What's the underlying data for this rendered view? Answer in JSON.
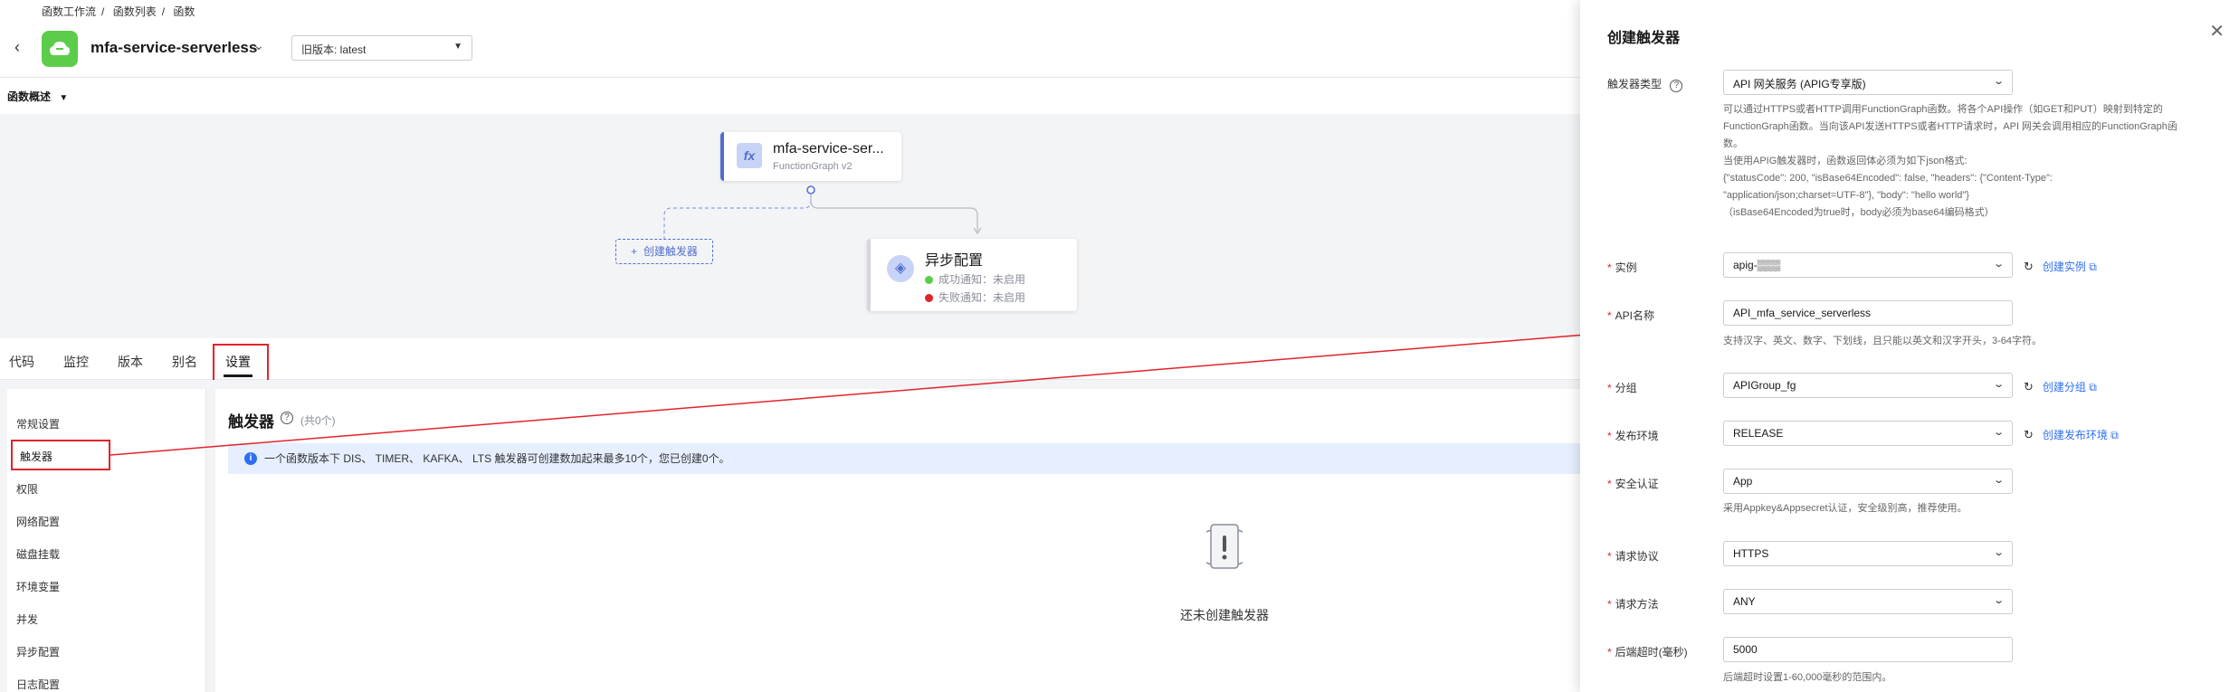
{
  "breadcrumb": [
    "函数工作流",
    "函数列表",
    "函数"
  ],
  "header": {
    "function_name": "mfa-service-serverless",
    "version_label": "旧版本: latest"
  },
  "overview": {
    "title": "函数概述",
    "function_node": {
      "title": "mfa-service-ser...",
      "subtitle": "FunctionGraph v2"
    },
    "create_trigger": "创建触发器",
    "async_node": {
      "title": "异步配置",
      "success": "成功通知：未启用",
      "failure": "失败通知：未启用"
    }
  },
  "tabs": [
    "代码",
    "监控",
    "版本",
    "别名",
    "设置"
  ],
  "active_tab": "设置",
  "settings_menu": [
    "常规设置",
    "触发器",
    "权限",
    "网络配置",
    "磁盘挂载",
    "环境变量",
    "并发",
    "异步配置",
    "日志配置"
  ],
  "active_menu": "触发器",
  "triggers_panel": {
    "title": "触发器",
    "count": "(共0个)",
    "info": "一个函数版本下 DIS、 TIMER、 KAFKA、 LTS 触发器可创建数加起来最多10个，您已创建0个。",
    "empty": "还未创建触发器"
  },
  "drawer": {
    "title": "创建触发器",
    "trigger_type": {
      "label": "触发器类型",
      "value": "API 网关服务 (APIG专享版)"
    },
    "trigger_desc": [
      "可以通过HTTPS或者HTTP调用FunctionGraph函数。将各个API操作（如GET和PUT）映射到特定的",
      "FunctionGraph函数。当向该API发送HTTPS或者HTTP请求时，API 网关会调用相应的FunctionGraph函",
      "数。",
      "当使用APIG触发器时，函数返回体必须为如下json格式:",
      "{\"statusCode\": 200, \"isBase64Encoded\": false, \"headers\": {\"Content-Type\":",
      "\"application/json;charset=UTF-8\"}, \"body\": \"hello world\"}",
      "（isBase64Encoded为true时，body必须为base64编码格式）"
    ],
    "instance": {
      "label": "实例",
      "value": "apig-▒▒▒",
      "link": "创建实例"
    },
    "api_name": {
      "label": "API名称",
      "value": "API_mfa_service_serverless",
      "hint": "支持汉字、英文、数字、下划线，且只能以英文和汉字开头，3-64字符。"
    },
    "group": {
      "label": "分组",
      "value": "APIGroup_fg",
      "link": "创建分组"
    },
    "env": {
      "label": "发布环境",
      "value": "RELEASE",
      "link": "创建发布环境"
    },
    "auth": {
      "label": "安全认证",
      "value": "App",
      "hint": "采用Appkey&Appsecret认证，安全级别高，推荐使用。"
    },
    "protocol": {
      "label": "请求协议",
      "value": "HTTPS"
    },
    "method": {
      "label": "请求方法",
      "value": "ANY"
    },
    "timeout": {
      "label": "后端超时(毫秒)",
      "value": "5000",
      "hint": "后端超时设置1-60,000毫秒的范围内。"
    }
  },
  "colors": {
    "annotation_red": "#e1242b",
    "accent_blue": "#2d6ff0",
    "brand_green": "#5ccd4a"
  }
}
